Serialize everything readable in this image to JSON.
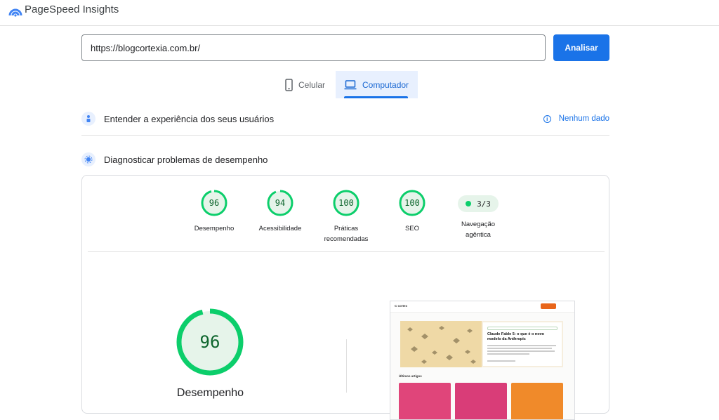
{
  "app": {
    "title": "PageSpeed Insights"
  },
  "search": {
    "url_value": "https://blogcortexia.com.br/",
    "analyze_label": "Analisar"
  },
  "tabs": [
    {
      "label": "Celular",
      "icon": "phone-icon",
      "selected": false
    },
    {
      "label": "Computador",
      "icon": "laptop-icon",
      "selected": true
    }
  ],
  "sections": {
    "user_experience": {
      "label": "Entender a experiência dos seus usuários",
      "status": "Nenhum dado"
    },
    "diagnostics": {
      "label": "Diagnosticar problemas de desempenho"
    }
  },
  "scores": [
    {
      "value": "96",
      "label": "Desempenho"
    },
    {
      "value": "94",
      "label": "Acessibilidade"
    },
    {
      "value": "100",
      "label": "Práticas recomendadas"
    },
    {
      "value": "100",
      "label": "SEO"
    }
  ],
  "agentic": {
    "value": "3/3",
    "label": "Navegação agêntica"
  },
  "main_score": {
    "value": "96",
    "label": "Desempenho"
  },
  "screenshot": {
    "article_title": "Claude Fable 5: o que é o novo modelo da Anthropic",
    "section_title": "Últimos artigos"
  },
  "colors": {
    "accent": "#1a73e8",
    "pass": "#0cce6b",
    "pass_text": "#0d652d",
    "pass_fill": "#e6f4ea"
  }
}
